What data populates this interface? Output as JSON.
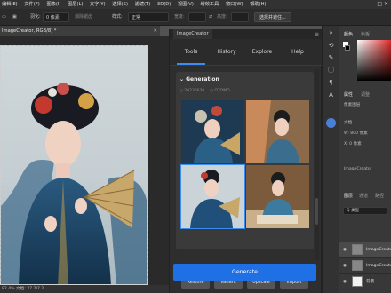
{
  "menubar": {
    "items": [
      "☰",
      "编辑(E)",
      "文件(F)",
      "图像(I)",
      "图层(L)",
      "文字(Y)",
      "选择(S)",
      "滤镜(T)",
      "3D(D)",
      "视图(V)",
      "增效工具",
      "窗口(W)",
      "帮助(H)"
    ],
    "window_controls": "—  □  ✕"
  },
  "options": {
    "feather_label": "羽化:",
    "feather_value": "0 像素",
    "antialias_label": "消除锯齿",
    "style_label": "样式:",
    "style_value": "正常",
    "width_label": "宽度:",
    "height_label": "高度:",
    "select_subject": "选择并遮住..."
  },
  "document": {
    "tab_title": "ImageCreator, RGB/8) *",
    "status": "82.4% 文档: 27.2/7.2"
  },
  "plugin": {
    "title": "ImageCreator",
    "tabs": [
      "Tools",
      "History",
      "Explore",
      "Help"
    ],
    "active_tab": "Tools",
    "section": "Generation",
    "radio_a": "○ 20230630",
    "radio_b": "○ OTOMO",
    "actions": [
      "Restore",
      "Variant",
      "Upscale",
      "Import"
    ],
    "generate_label": "Generate",
    "accent": "#1f6fe5"
  },
  "right": {
    "color_tab": "颜色",
    "swatch_tab": "色板",
    "props_tab": "属性",
    "adjust_tab": "调整",
    "pixel_layer": "像素图层",
    "doc_label": "文档",
    "w_label": "W: 800 像素",
    "x_label": "X: 0 像素",
    "layer_name": "ImageCreator",
    "layers_tab": "图层",
    "channels_tab": "通道",
    "paths_tab": "路径",
    "filter_label": "Q 类型",
    "layers": [
      "ImageCreator",
      "ImageCreator",
      "背景"
    ]
  }
}
